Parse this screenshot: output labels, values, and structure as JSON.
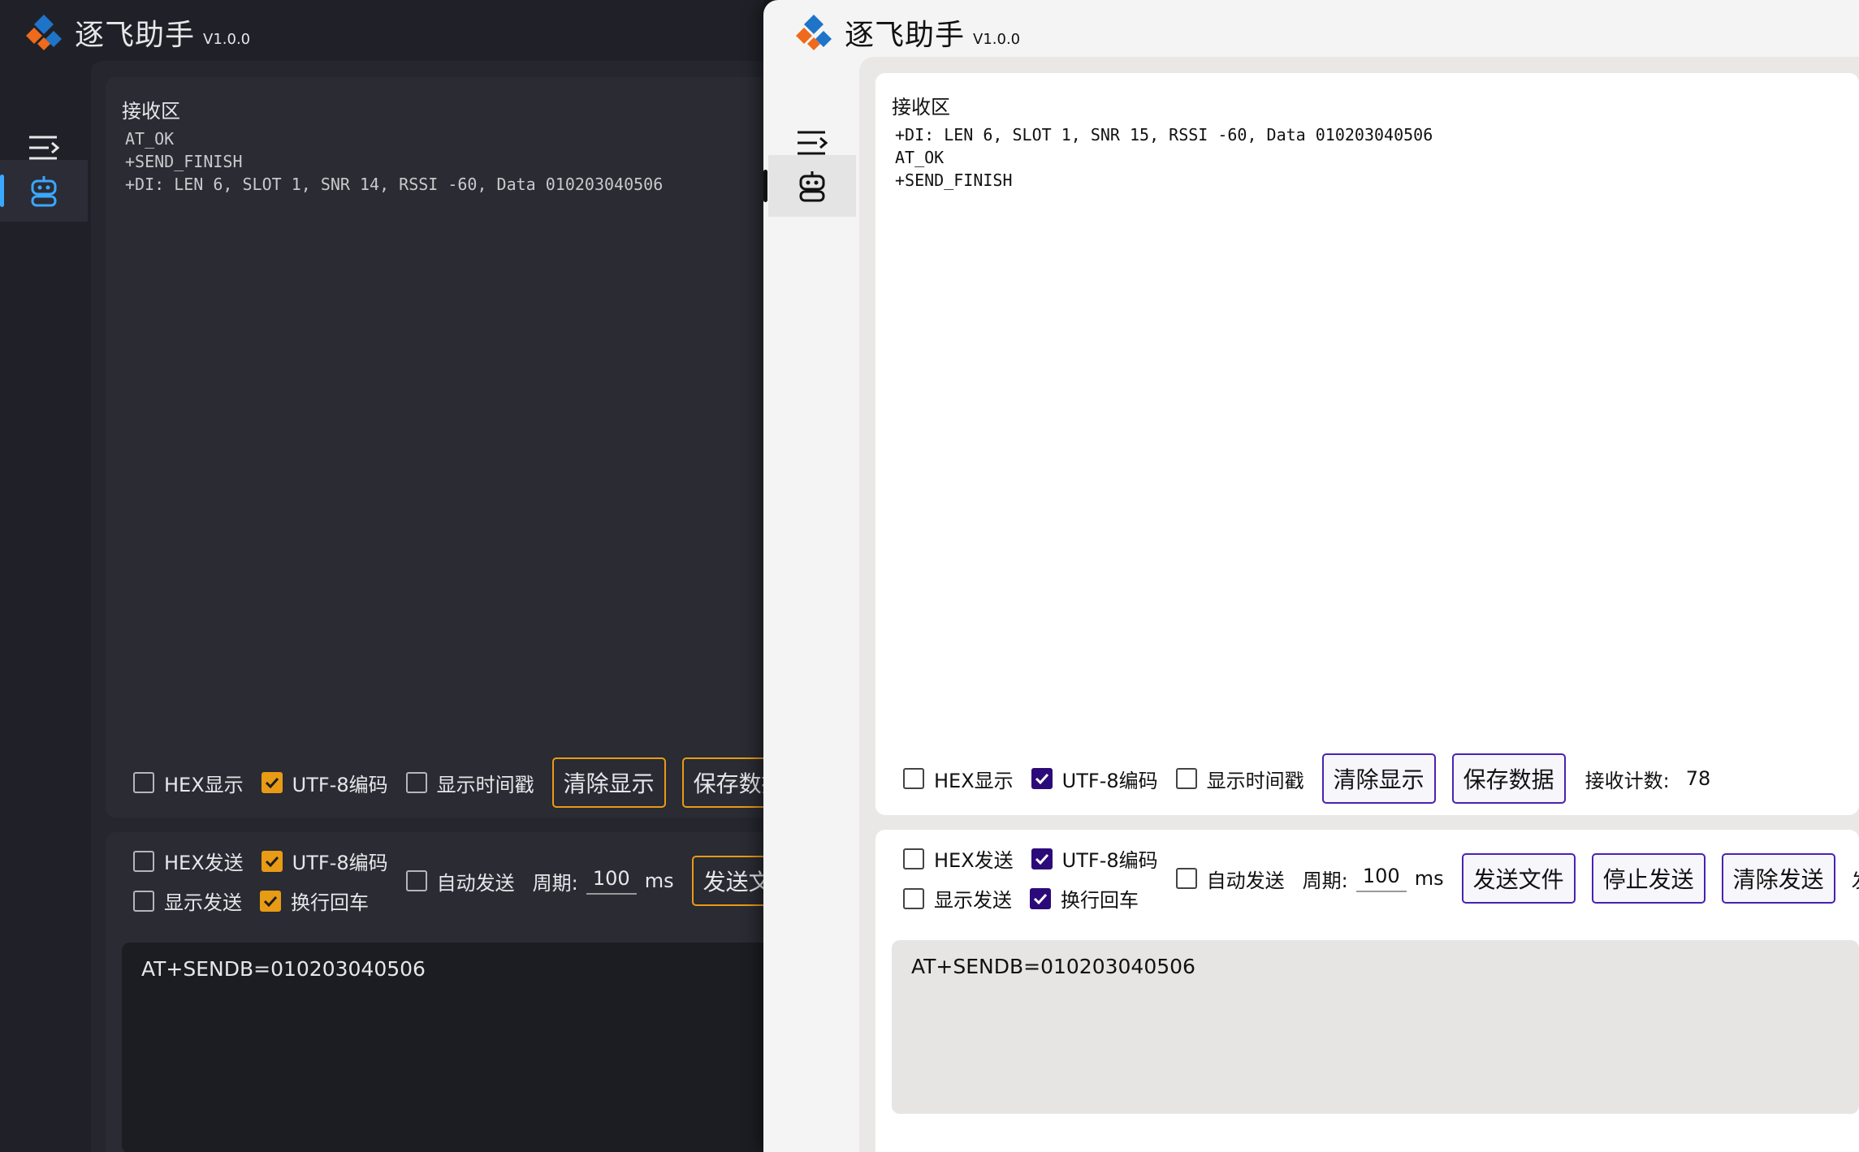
{
  "app": {
    "title": "逐飞助手",
    "version": "V1.0.0"
  },
  "colors": {
    "dark_accent": "#e89b14",
    "light_accent": "#4a22b0",
    "light_check": "#2b0b79",
    "logo_blue": "#1e74c8",
    "logo_orange": "#ee6a1c"
  },
  "icons": {
    "menu": "menu-collapse-icon",
    "robot": "robot-icon",
    "logo": "app-logo-icon"
  },
  "dark": {
    "receive": {
      "title": "接收区",
      "text": "AT_OK\n+SEND_FINISH\n+DI: LEN 6, SLOT 1, SNR 14, RSSI -60, Data 010203040506"
    },
    "recv_options": {
      "hex_display": "HEX显示",
      "utf8": "UTF-8编码",
      "timestamp": "显示时间戳"
    },
    "recv_buttons": {
      "clear": "清除显示",
      "save": "保存数据"
    },
    "send_options": {
      "hex_send": "HEX发送",
      "utf8": "UTF-8编码",
      "show_send": "显示发送",
      "newline": "换行回车",
      "auto_send": "自动发送",
      "period_label": "周期:",
      "period_value": "100",
      "period_unit": "ms"
    },
    "send_buttons": {
      "send_file": "发送文件"
    },
    "send_text": "AT+SENDB=010203040506"
  },
  "light": {
    "receive": {
      "title": "接收区",
      "text": "+DI: LEN 6, SLOT 1, SNR 15, RSSI -60, Data 010203040506\nAT_OK\n+SEND_FINISH"
    },
    "recv_options": {
      "hex_display": "HEX显示",
      "utf8": "UTF-8编码",
      "timestamp": "显示时间戳"
    },
    "recv_buttons": {
      "clear": "清除显示",
      "save": "保存数据"
    },
    "recv_count_label": "接收计数:",
    "recv_count_value": "78",
    "send_options": {
      "hex_send": "HEX发送",
      "utf8": "UTF-8编码",
      "show_send": "显示发送",
      "newline": "换行回车",
      "auto_send": "自动发送",
      "period_label": "周期:",
      "period_value": "100",
      "period_unit": "ms"
    },
    "send_buttons": {
      "send_file": "发送文件",
      "stop_send": "停止发送",
      "clear_send": "清除发送",
      "send_count_label": "发送计数:"
    },
    "send_text": "AT+SENDB=010203040506"
  }
}
